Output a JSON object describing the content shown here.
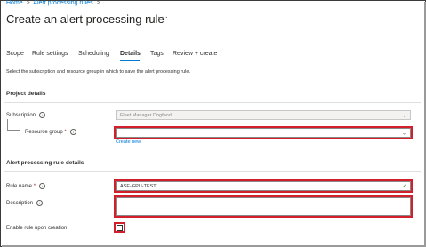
{
  "breadcrumb": {
    "home": "Home",
    "sep": ">",
    "item": "Alert processing rules",
    "sep2": ">"
  },
  "page_title": "Create an alert processing rule",
  "more_label": "···",
  "tabs": [
    {
      "label": "Scope",
      "active": false
    },
    {
      "label": "Rule settings",
      "active": false
    },
    {
      "label": "Scheduling",
      "active": false
    },
    {
      "label": "Details",
      "active": true
    },
    {
      "label": "Tags",
      "active": false
    },
    {
      "label": "Review + create",
      "active": false
    }
  ],
  "description": "Select the subscription and resource group in which to save the alert processing rule.",
  "project_details": {
    "heading": "Project details",
    "subscription_label": "Subscription",
    "subscription_value": "Fleet Manager Dogfood",
    "resource_group_label": "Resource group",
    "required_mark": "*",
    "resource_group_value": "",
    "create_new_link": "Create new"
  },
  "rule_details": {
    "heading": "Alert processing rule details",
    "rule_name_label": "Rule name",
    "required_mark": "*",
    "rule_name_value": "ASE-GPU-TEST",
    "description_label": "Description",
    "description_value": "",
    "enable_label": "Enable rule upon creation",
    "enable_checked": false
  },
  "icons": {
    "info": "info-icon",
    "chevron": "chevron-down-icon",
    "check": "check-icon"
  },
  "colors": {
    "accent": "#0078d4",
    "highlight": "#d21f2b",
    "valid": "#107c10"
  }
}
